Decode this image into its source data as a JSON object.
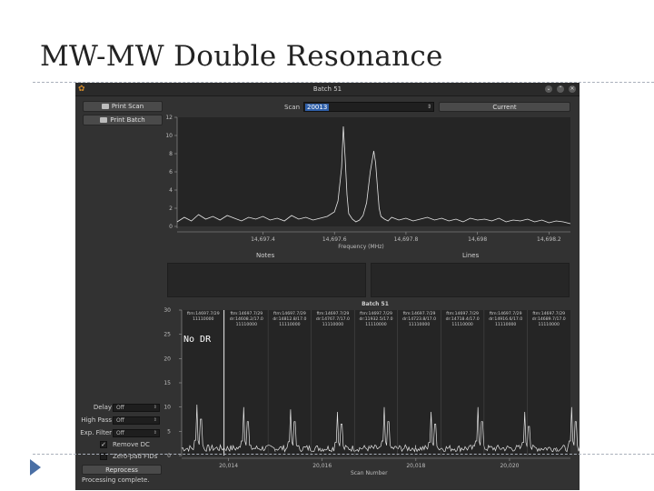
{
  "slide": {
    "title": "MW-MW Double Resonance"
  },
  "window": {
    "title": "Batch 51"
  },
  "toolbar": {
    "print_scan": "Print Scan",
    "print_batch": "Print Batch",
    "scan_label": "Scan",
    "scan_value": "20013",
    "current_button": "Current"
  },
  "sections": {
    "notes": "Notes",
    "lines": "Lines"
  },
  "controls": {
    "delay": {
      "label": "Delay",
      "value": "Off"
    },
    "high_pass": {
      "label": "High Pass",
      "value": "Off"
    },
    "exp_filter": {
      "label": "Exp. Filter",
      "value": "Off"
    },
    "remove_dc": {
      "label": "Remove DC",
      "checked": true
    },
    "zero_pad": {
      "label": "Zero-pad FIDs",
      "checked": false
    },
    "reprocess": "Reprocess"
  },
  "status": "Processing complete.",
  "chart_data": [
    {
      "type": "line",
      "title": "",
      "xlabel": "Frequency (MHz)",
      "ylabel": "",
      "xlim": [
        14697.16,
        14698.26
      ],
      "ylim": [
        0,
        12
      ],
      "xticks": [
        14697.4,
        14697.6,
        14697.8,
        14698,
        14698.2
      ],
      "xtick_labels": [
        "14,697.4",
        "14,697.6",
        "14,697.8",
        "14,698",
        "14,698.2"
      ],
      "yticks": [
        0,
        2,
        4,
        6,
        8,
        10,
        12
      ],
      "series": [
        {
          "x": [
            14697.16,
            14697.18,
            14697.2,
            14697.22,
            14697.24,
            14697.26,
            14697.28,
            14697.3,
            14697.32,
            14697.34,
            14697.36,
            14697.38,
            14697.4,
            14697.42,
            14697.44,
            14697.46,
            14697.48,
            14697.5,
            14697.52,
            14697.54,
            14697.56,
            14697.58,
            14697.6,
            14697.61,
            14697.62,
            14697.625,
            14697.63,
            14697.635,
            14697.64,
            14697.65,
            14697.66,
            14697.67,
            14697.68,
            14697.69,
            14697.7,
            14697.71,
            14697.715,
            14697.72,
            14697.725,
            14697.73,
            14697.74,
            14697.75,
            14697.76,
            14697.78,
            14697.8,
            14697.82,
            14697.84,
            14697.86,
            14697.88,
            14697.9,
            14697.92,
            14697.94,
            14697.96,
            14697.98,
            14698,
            14698.02,
            14698.04,
            14698.06,
            14698.08,
            14698.1,
            14698.12,
            14698.14,
            14698.16,
            14698.18,
            14698.2,
            14698.22,
            14698.24,
            14698.26
          ],
          "y": [
            0.5,
            1.0,
            0.6,
            1.3,
            0.8,
            1.1,
            0.7,
            1.2,
            0.9,
            0.6,
            1.0,
            0.8,
            1.1,
            0.7,
            0.9,
            0.6,
            1.2,
            0.8,
            1.0,
            0.7,
            0.9,
            1.1,
            1.6,
            2.8,
            6.5,
            11.0,
            7.5,
            3.5,
            1.4,
            0.8,
            0.5,
            0.7,
            1.2,
            2.6,
            6.0,
            8.3,
            7.0,
            4.5,
            2.0,
            1.1,
            0.8,
            0.6,
            1.0,
            0.7,
            0.9,
            0.6,
            0.8,
            1.0,
            0.7,
            0.9,
            0.6,
            0.8,
            0.5,
            0.9,
            0.7,
            0.8,
            0.6,
            0.9,
            0.5,
            0.7,
            0.6,
            0.8,
            0.5,
            0.7,
            0.4,
            0.6,
            0.5,
            0.3
          ]
        }
      ]
    },
    {
      "type": "line",
      "title": "Batch 51",
      "xlabel": "Scan Number",
      "ylabel": "",
      "xlim": [
        20013,
        20021.3
      ],
      "ylim": [
        0,
        30
      ],
      "xticks": [
        20014,
        20016,
        20018,
        20020
      ],
      "xtick_labels": [
        "20,014",
        "20,016",
        "20,018",
        "20,020"
      ],
      "yticks": [
        0,
        5,
        10,
        15,
        20,
        25,
        30
      ],
      "annotation": "No DR",
      "segments": [
        {
          "l1": "ftm:14697.7/29",
          "l2": "11110000",
          "l3": ""
        },
        {
          "l1": "ftm:14697.7/29",
          "l2": "dr:14608.2/17.0",
          "l3": "11110000"
        },
        {
          "l1": "ftm:14697.7/29",
          "l2": "dr:14812.8/17.0",
          "l3": "11110000"
        },
        {
          "l1": "ftm:14697.7/29",
          "l2": "dr:14767.7/17.0",
          "l3": "11110000"
        },
        {
          "l1": "ftm:14697.7/29",
          "l2": "dr:11932.5/17.0",
          "l3": "11110000"
        },
        {
          "l1": "ftm:14697.7/29",
          "l2": "dr:14723.8/17.0",
          "l3": "11110000"
        },
        {
          "l1": "ftm:14697.7/29",
          "l2": "dr:14718.4/17.0",
          "l3": "11110000"
        },
        {
          "l1": "ftm:14697.7/29",
          "l2": "dr:14916.6/17.0",
          "l3": "11110000"
        },
        {
          "l1": "ftm:14697.7/29",
          "l2": "dr:14689.7/17.0",
          "l3": "11110000"
        }
      ],
      "peaks_per_scan": [
        {
          "scan": 20013,
          "heights": [
            10.5,
            7.5
          ]
        },
        {
          "scan": 20014,
          "heights": [
            10.0,
            7.0
          ]
        },
        {
          "scan": 20015,
          "heights": [
            9.5,
            7.0
          ]
        },
        {
          "scan": 20016,
          "heights": [
            9.0,
            6.5
          ]
        },
        {
          "scan": 20017,
          "heights": [
            10.0,
            7.0
          ]
        },
        {
          "scan": 20018,
          "heights": [
            9.0,
            6.5
          ]
        },
        {
          "scan": 20019,
          "heights": [
            10.0,
            7.0
          ]
        },
        {
          "scan": 20020,
          "heights": [
            9.0,
            6.0
          ]
        },
        {
          "scan": 20021,
          "heights": [
            10.0,
            7.0
          ]
        }
      ]
    }
  ]
}
